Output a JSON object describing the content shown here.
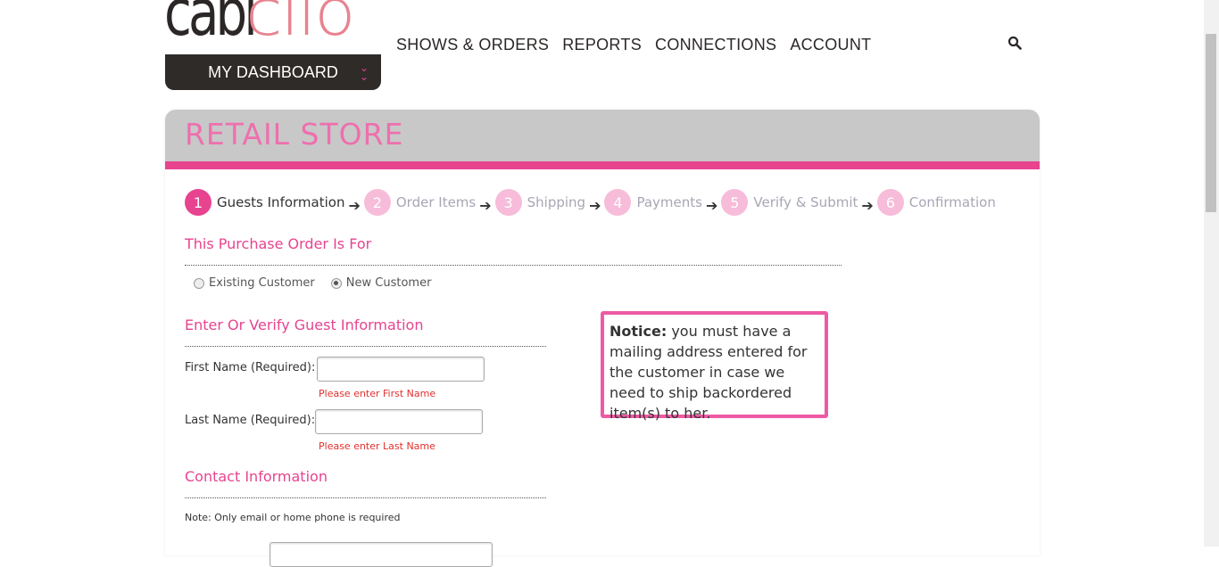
{
  "logo": {
    "text_primary": "cabi",
    "text_secondary": "clio"
  },
  "dashboard": {
    "label": "MY DASHBOARD",
    "icon": "chevron-double-down-icon"
  },
  "nav": {
    "items": [
      {
        "label": "SHOWS & ORDERS"
      },
      {
        "label": "REPORTS"
      },
      {
        "label": "CONNECTIONS"
      },
      {
        "label": "ACCOUNT"
      }
    ],
    "search_icon": "search-icon"
  },
  "page": {
    "title": "RETAIL STORE"
  },
  "steps": [
    {
      "num": "1",
      "label": "Guests Information",
      "active": true
    },
    {
      "num": "2",
      "label": "Order Items"
    },
    {
      "num": "3",
      "label": "Shipping"
    },
    {
      "num": "4",
      "label": "Payments"
    },
    {
      "num": "5",
      "label": "Verify & Submit"
    },
    {
      "num": "6",
      "label": "Confirmation"
    }
  ],
  "purchase": {
    "title": "This Purchase Order Is For",
    "options": [
      {
        "label": "Existing Customer",
        "selected": false
      },
      {
        "label": "New Customer",
        "selected": true
      }
    ]
  },
  "guest": {
    "title": "Enter Or Verify Guest Information",
    "first_name_label": "First Name (Required):",
    "first_name_value": "",
    "first_name_error": "Please enter First Name",
    "last_name_label": "Last Name (Required):",
    "last_name_value": "",
    "last_name_error": "Please enter Last Name"
  },
  "notice": {
    "heading": "Notice:",
    "text": " you must have a mailing address entered for the customer in case we need to ship backordered item(s) to her."
  },
  "contact": {
    "title": "Contact Information",
    "note": "Note: Only email or home phone is required"
  },
  "colors": {
    "accent": "#e8438f",
    "light_accent": "#f7bcd9",
    "dark": "#2f2b29",
    "logo_pink": "#e8838f"
  }
}
